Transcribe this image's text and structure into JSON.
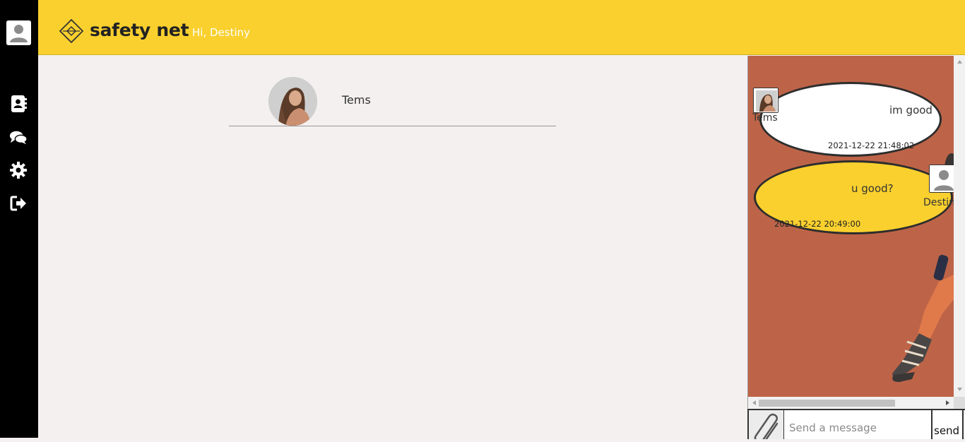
{
  "app": {
    "name": "safety net",
    "greeting": "Hi, Destiny"
  },
  "sidebar": {
    "avatar_icon": "user-avatar-icon",
    "items": [
      {
        "name": "contacts",
        "icon": "address-book-icon"
      },
      {
        "name": "chats",
        "icon": "comments-icon"
      },
      {
        "name": "settings",
        "icon": "gear-icon"
      },
      {
        "name": "logout",
        "icon": "sign-out-icon"
      }
    ]
  },
  "contacts": [
    {
      "name": "Tems"
    }
  ],
  "chat": {
    "messages": [
      {
        "sender": "Tems",
        "text": "im good",
        "time": "2021-12-22 21:48:02"
      },
      {
        "sender": "Destiny",
        "text": "u good?",
        "time": "2021-12-22 20:49:00"
      }
    ],
    "input_placeholder": "Send a message",
    "send_label": "send"
  },
  "colors": {
    "header": "#f9d02e",
    "sidebar": "#000000",
    "chat_background": "#bd6448",
    "incoming_bubble": "#ffffff",
    "outgoing_bubble": "#f9d02e"
  }
}
